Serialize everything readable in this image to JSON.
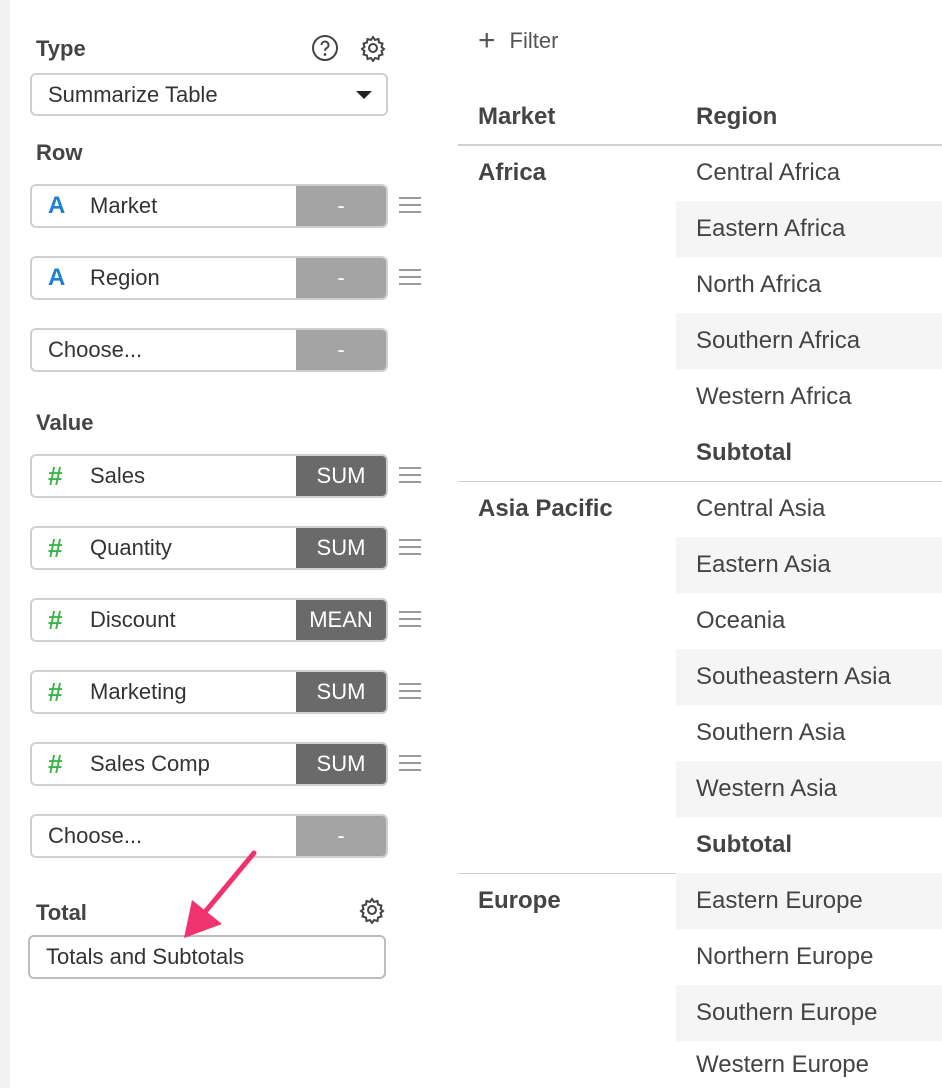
{
  "settings": {
    "type_label": "Type",
    "type_value": "Summarize Table",
    "row_label": "Row",
    "rows": [
      {
        "icon": "text-type-icon",
        "glyph": "A",
        "name": "Market",
        "action": "-"
      },
      {
        "icon": "text-type-icon",
        "glyph": "A",
        "name": "Region",
        "action": "-"
      },
      {
        "icon": "",
        "glyph": "",
        "name": "Choose...",
        "action": "-"
      }
    ],
    "value_label": "Value",
    "values": [
      {
        "icon": "number-type-icon",
        "glyph": "#",
        "name": "Sales",
        "agg": "SUM"
      },
      {
        "icon": "number-type-icon",
        "glyph": "#",
        "name": "Quantity",
        "agg": "SUM"
      },
      {
        "icon": "number-type-icon",
        "glyph": "#",
        "name": "Discount",
        "agg": "MEAN"
      },
      {
        "icon": "number-type-icon",
        "glyph": "#",
        "name": "Marketing",
        "agg": "SUM"
      },
      {
        "icon": "number-type-icon",
        "glyph": "#",
        "name": "Sales Comp",
        "agg": "SUM"
      },
      {
        "icon": "",
        "glyph": "",
        "name": "Choose...",
        "agg": "-"
      }
    ],
    "total_label": "Total",
    "total_value": "Totals and Subtotals",
    "annotation_color": "#f0336e"
  },
  "table": {
    "filter_label": "Filter",
    "columns": [
      "Market",
      "Region"
    ],
    "groups": [
      {
        "market": "Africa",
        "regions": [
          "Central Africa",
          "Eastern Africa",
          "North Africa",
          "Southern Africa",
          "Western Africa",
          "Subtotal"
        ]
      },
      {
        "market": "Asia Pacific",
        "regions": [
          "Central Asia",
          "Eastern Asia",
          "Oceania",
          "Southeastern Asia",
          "Southern Asia",
          "Western Asia",
          "Subtotal"
        ]
      },
      {
        "market": "Europe",
        "regions": [
          "Eastern Europe",
          "Northern Europe",
          "Southern Europe",
          "Western Europe"
        ]
      }
    ]
  }
}
